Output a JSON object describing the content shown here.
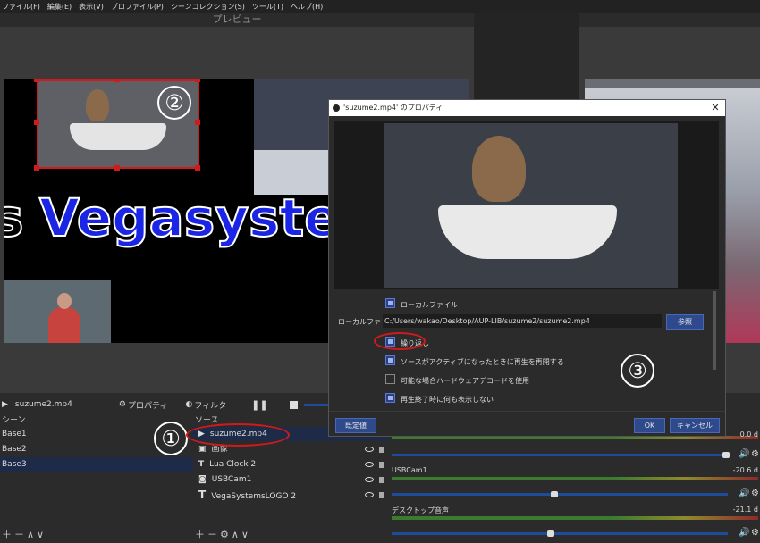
{
  "menu": [
    "ファイル(F)",
    "編集(E)",
    "表示(V)",
    "プロファイル(P)",
    "シーンコレクション(S)",
    "ツール(T)",
    "ヘルプ(H)"
  ],
  "preview_label": "プレビュー",
  "canvas": {
    "banner_text": "Vegasyste",
    "banner_prefix": "s"
  },
  "source_toolbar": {
    "selected_source": "suzume2.mp4",
    "properties_label": "プロパティ",
    "filters_label": "フィルタ"
  },
  "scenes": {
    "title": "シーン",
    "items": [
      "Base1",
      "Base2",
      "Base3"
    ],
    "active_index": 2
  },
  "sources": {
    "title": "ソース",
    "items": [
      {
        "label": "suzume2.mp4",
        "icon": "play-icon"
      },
      {
        "label": "画像",
        "icon": "image-icon"
      },
      {
        "label": "Lua Clock 2",
        "icon": "text-icon"
      },
      {
        "label": "USBCam1",
        "icon": "camera-icon"
      },
      {
        "label": "VegaSystemsLOGO 2",
        "icon": "text-icon"
      }
    ]
  },
  "mixer": {
    "channels": [
      {
        "name": "",
        "db": "0.0 d",
        "volume": 0.98
      },
      {
        "name": "USBCam1",
        "db": "-20.6 d",
        "volume": 0.45
      },
      {
        "name": "デスクトップ音声",
        "db": "-21.1 d",
        "volume": 0.43
      }
    ]
  },
  "dialog": {
    "title": "'suzume2.mp4' のプロパティ",
    "local_file_checkbox": "ローカルファイル",
    "local_file_label": "ローカルファイル",
    "path": "C:/Users/wakao/Desktop/AUP-LIB/suzume2/suzume2.mp4",
    "browse_button": "参照",
    "loop_label": "繰り返し",
    "restart_label": "ソースがアクティブになったときに再生を再開する",
    "hwdecode_label": "可能な場合ハードウェアデコードを使用",
    "hide_label": "再生終了時に何も表示しない",
    "defaults_button": "既定値",
    "ok_button": "OK",
    "cancel_button": "キャンセル",
    "checks": {
      "local_file": true,
      "loop": true,
      "restart": true,
      "hwdecode": false,
      "hide": true
    }
  },
  "annotations": [
    "②",
    "①",
    "③"
  ],
  "colors": {
    "accent": "#29418a",
    "highlight_red": "#d11a1a",
    "banner_blue": "#1a25e6"
  }
}
